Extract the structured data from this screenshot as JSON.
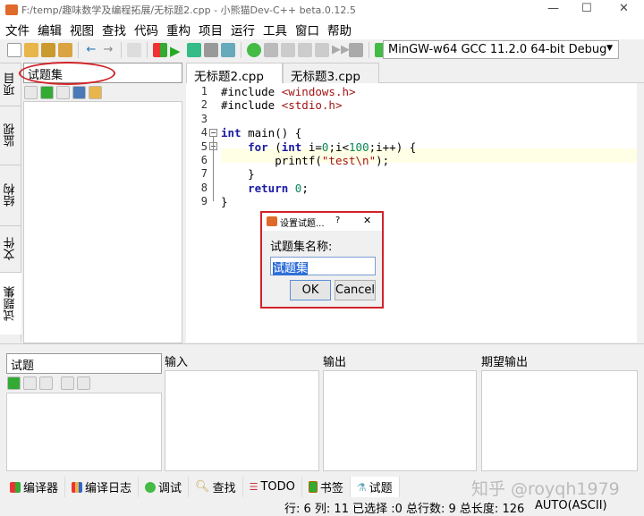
{
  "window": {
    "title": "F:/temp/趣味数学及编程拓展/无标题2.cpp - 小熊猫Dev-C++ beta.0.12.5",
    "minimize": "—",
    "maximize": "☐",
    "close": "✕"
  },
  "menu": [
    "文件",
    "编辑",
    "视图",
    "查找",
    "代码",
    "重构",
    "项目",
    "运行",
    "工具",
    "窗口",
    "帮助"
  ],
  "toolbar": {
    "compiler": "MinGW-w64 GCC 11.2.0 64-bit Debug"
  },
  "side_tabs": [
    "项目",
    "监视",
    "结构",
    "文件",
    "试题集"
  ],
  "left_panel": {
    "set_name": "试题集"
  },
  "editor_tabs": [
    {
      "label": "无标题2.cpp",
      "close": "✕"
    },
    {
      "label": "无标题3.cpp",
      "close": "✕"
    }
  ],
  "code": {
    "line_numbers": [
      "1",
      "2",
      "3",
      "4",
      "5",
      "6",
      "7",
      "8",
      "9"
    ]
  },
  "bottom": {
    "test_name": "试题",
    "input_label": "输入",
    "output_label": "输出",
    "expected_label": "期望输出"
  },
  "bottom_tabs": [
    "编译器",
    "编译日志",
    "调试",
    "查找",
    "TODO",
    "书签",
    "试题"
  ],
  "status": {
    "position": "行: 6 列: 11 已选择 :0 总行数: 9 总长度: 126",
    "encoding": "AUTO(ASCII)"
  },
  "watermark": "知乎 @royqh1979",
  "dialog": {
    "title": "设置试题...",
    "help": "?",
    "close": "✕",
    "label": "试题集名称:",
    "value": "试题集",
    "ok": "OK",
    "cancel": "Cancel"
  },
  "colors": {
    "highlight": "#d0242a",
    "selection": "#2f6fd8",
    "current_line": "#ffffe6"
  }
}
